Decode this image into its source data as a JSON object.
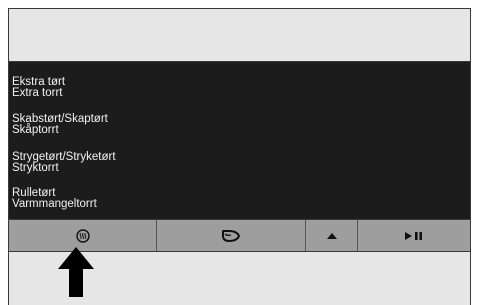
{
  "programs": [
    {
      "line1": "Ekstra tørt",
      "line2": "Extra torrt"
    },
    {
      "line1": "Skabstørt/Skaptørt",
      "line2": "Skåptorrt"
    },
    {
      "line1": "Strygetørt/Stryketørt",
      "line2": "Stryktorrt"
    },
    {
      "line1": "Rulletørt",
      "line2": "Varmmangeltorrt"
    }
  ],
  "buttons": [
    {
      "icon": "drying-level-icon"
    },
    {
      "icon": "low-heat-icon"
    },
    {
      "icon": "up-arrow-icon"
    },
    {
      "icon": "play-pause-icon"
    }
  ],
  "colors": {
    "display_bg": "#1c1c1c",
    "button_bar": "#9e9e9e",
    "panel_bg": "#e6e6e6",
    "arrow": "#000000"
  }
}
